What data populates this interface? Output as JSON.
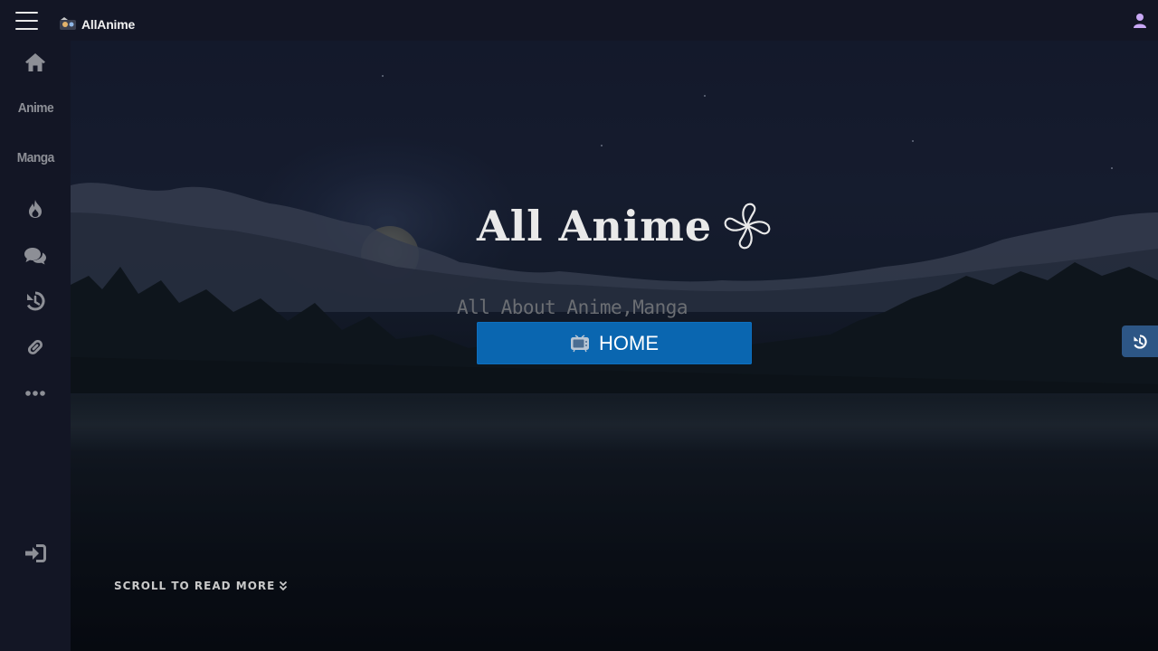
{
  "header": {
    "brand_name": "AllAnime",
    "menu_icon": "hamburger-menu-icon",
    "user_icon": "user-icon"
  },
  "sidebar": {
    "items": [
      {
        "type": "icon",
        "icon": "home-icon"
      },
      {
        "type": "text",
        "label": "Anime"
      },
      {
        "type": "text",
        "label": "Manga"
      },
      {
        "type": "icon",
        "icon": "fire-icon"
      },
      {
        "type": "icon",
        "icon": "comments-icon"
      },
      {
        "type": "icon",
        "icon": "history-icon"
      },
      {
        "type": "icon",
        "icon": "link-icon"
      },
      {
        "type": "icon",
        "icon": "more-icon"
      }
    ],
    "login_icon": "sign-in-icon"
  },
  "hero": {
    "title": "All Anime",
    "title_icon": "pinwheel-icon",
    "subtitle": "All About Anime,Manga",
    "home_button_label": "HOME",
    "home_button_icon": "tv-icon",
    "scroll_label": "SCROLL TO READ MORE",
    "scroll_icon": "double-chevron-down-icon"
  },
  "floating": {
    "history_button_icon": "history-icon"
  },
  "colors": {
    "accent": "#0a66b0",
    "sidebar_bg": "#131625",
    "floating_button": "#2d5685",
    "user_icon": "#c9a8f5"
  }
}
